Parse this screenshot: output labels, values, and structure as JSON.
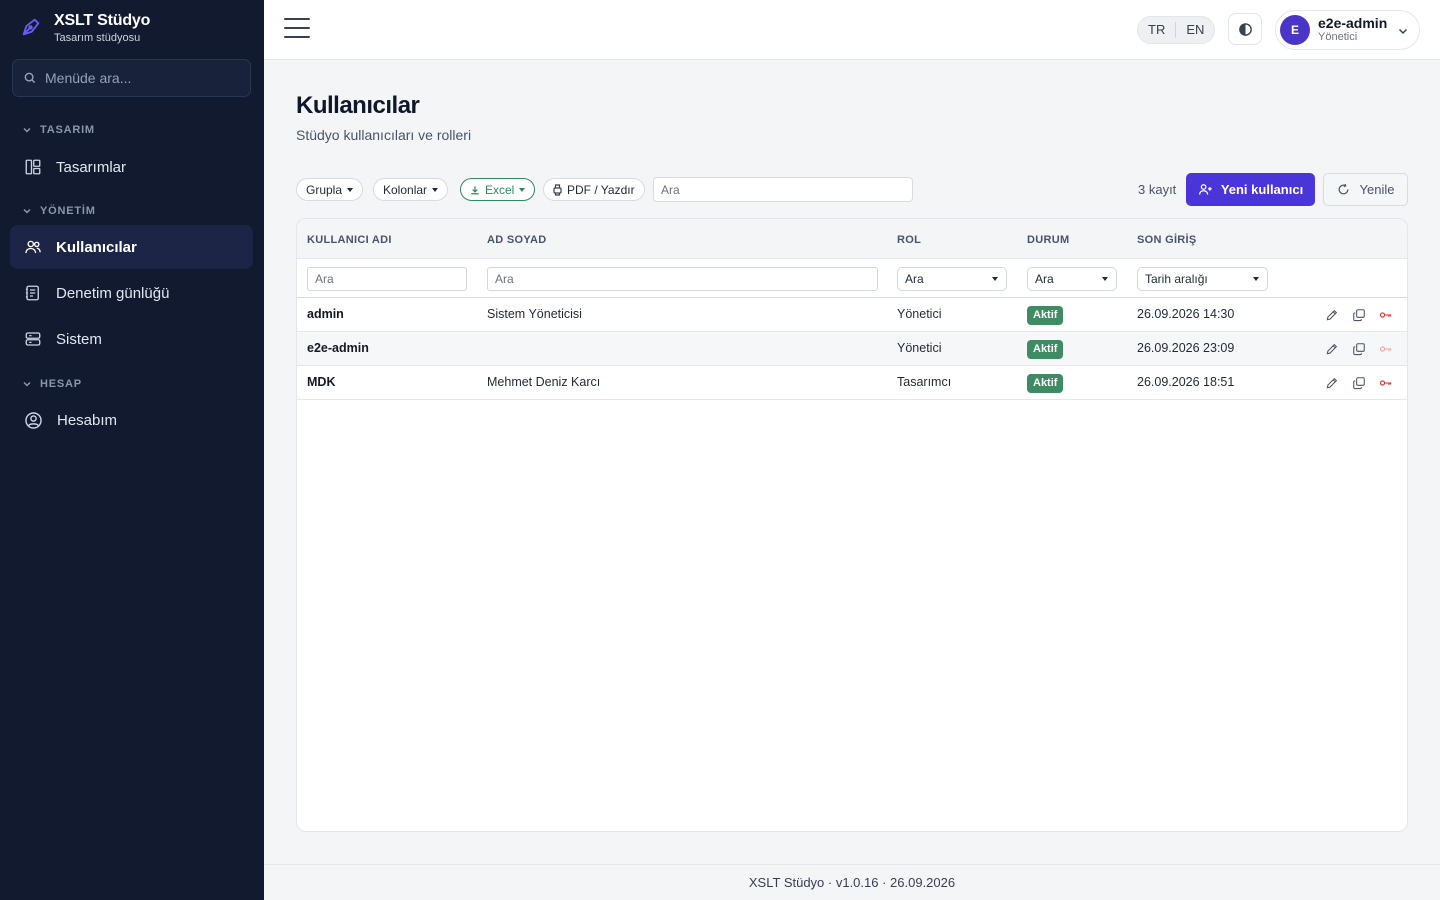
{
  "brand": {
    "title": "XSLT Stüdyo",
    "subtitle": "Tasarım stüdyosu"
  },
  "sidebar": {
    "search_placeholder": "Menüde ara...",
    "sections": [
      {
        "label": "TASARIM",
        "items": [
          {
            "label": "Tasarımlar",
            "icon": "layout-icon"
          }
        ]
      },
      {
        "label": "YÖNETİM",
        "items": [
          {
            "label": "Kullanıcılar",
            "icon": "users-icon",
            "active": true
          },
          {
            "label": "Denetim günlüğü",
            "icon": "audit-log-icon"
          },
          {
            "label": "Sistem",
            "icon": "server-icon"
          }
        ]
      },
      {
        "label": "HESAP",
        "items": [
          {
            "label": "Hesabım",
            "icon": "user-circle-icon"
          }
        ]
      }
    ]
  },
  "topbar": {
    "lang": {
      "tr": "TR",
      "en": "EN"
    },
    "user": {
      "initial": "E",
      "name": "e2e-admin",
      "role": "Yönetici"
    }
  },
  "page": {
    "title": "Kullanıcılar",
    "subtitle": "Stüdyo kullanıcıları ve rolleri"
  },
  "toolbar": {
    "group": "Grupla",
    "columns": "Kolonlar",
    "excel": "Excel",
    "pdf": "PDF / Yazdır",
    "search_placeholder": "Ara",
    "record_count": "3 kayıt",
    "new_user": "Yeni kullanıcı",
    "refresh": "Yenile"
  },
  "table": {
    "headers": {
      "username": "KULLANICI ADI",
      "fullname": "AD SOYAD",
      "role": "ROL",
      "status": "DURUM",
      "last_login": "SON GİRİŞ"
    },
    "filters": {
      "username": "Ara",
      "fullname": "Ara",
      "role": "Ara",
      "status": "Ara",
      "last_login": "Tarih aralığı"
    },
    "rows": [
      {
        "username": "admin",
        "fullname": "Sistem Yöneticisi",
        "role": "Yönetici",
        "status": "Aktif",
        "last_login": "26.09.2026 14:30"
      },
      {
        "username": "e2e-admin",
        "fullname": "",
        "role": "Yönetici",
        "status": "Aktif",
        "last_login": "26.09.2026 23:09"
      },
      {
        "username": "MDK",
        "fullname": "Mehmet Deniz Karcı",
        "role": "Tasarımcı",
        "status": "Aktif",
        "last_login": "26.09.2026 18:51"
      }
    ]
  },
  "colors": {
    "sidebar_bg": "#111a2e",
    "accent": "#4a35d9",
    "status_active": "#3f8b63",
    "excel": "#2f8a5f",
    "danger": "#dc2626"
  },
  "footer": {
    "text": "XSLT Stüdyo · v1.0.16 · 26.09.2026"
  }
}
